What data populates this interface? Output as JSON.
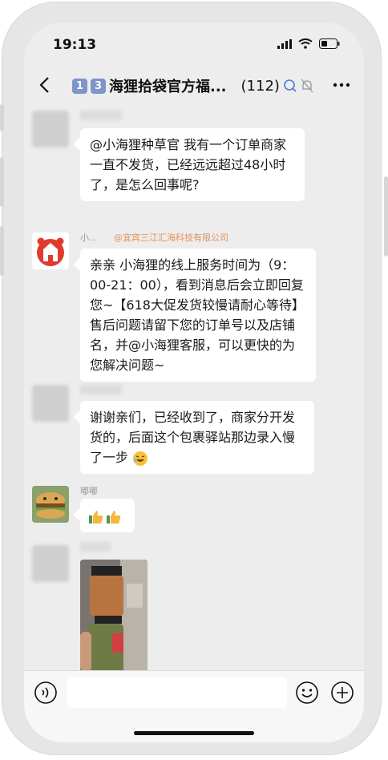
{
  "status": {
    "time": "19:13"
  },
  "header": {
    "badge1": "1",
    "badge2": "3",
    "title": "海狸拾袋官方福...",
    "count": "(112)"
  },
  "messages": [
    {
      "name": "",
      "text": "@小海狸种草官 我有一个订单商家一直不发货，已经远远超过48小时了，是怎么回事呢?"
    },
    {
      "name": "小...",
      "org": "@宜宾三江汇海科技有限公司",
      "text": "亲亲 小海狸的线上服务时间为（9：00-21：00），看到消息后会立即回复您~【618大促发货较慢请耐心等待】售后问题请留下您的订单号以及店铺名，并@小海狸客服，可以更快的为您解决问题~"
    },
    {
      "name": "",
      "text": "谢谢亲们，已经收到了，商家分开发货的，后面这个包裹驿站那边录入慢了一步"
    },
    {
      "name": "嘟嘟",
      "text": ""
    },
    {
      "name": "",
      "photo": "product-photo"
    }
  ],
  "colors": {
    "bg": "#ededed",
    "bubble": "#ffffff",
    "org": "#e1935a"
  }
}
